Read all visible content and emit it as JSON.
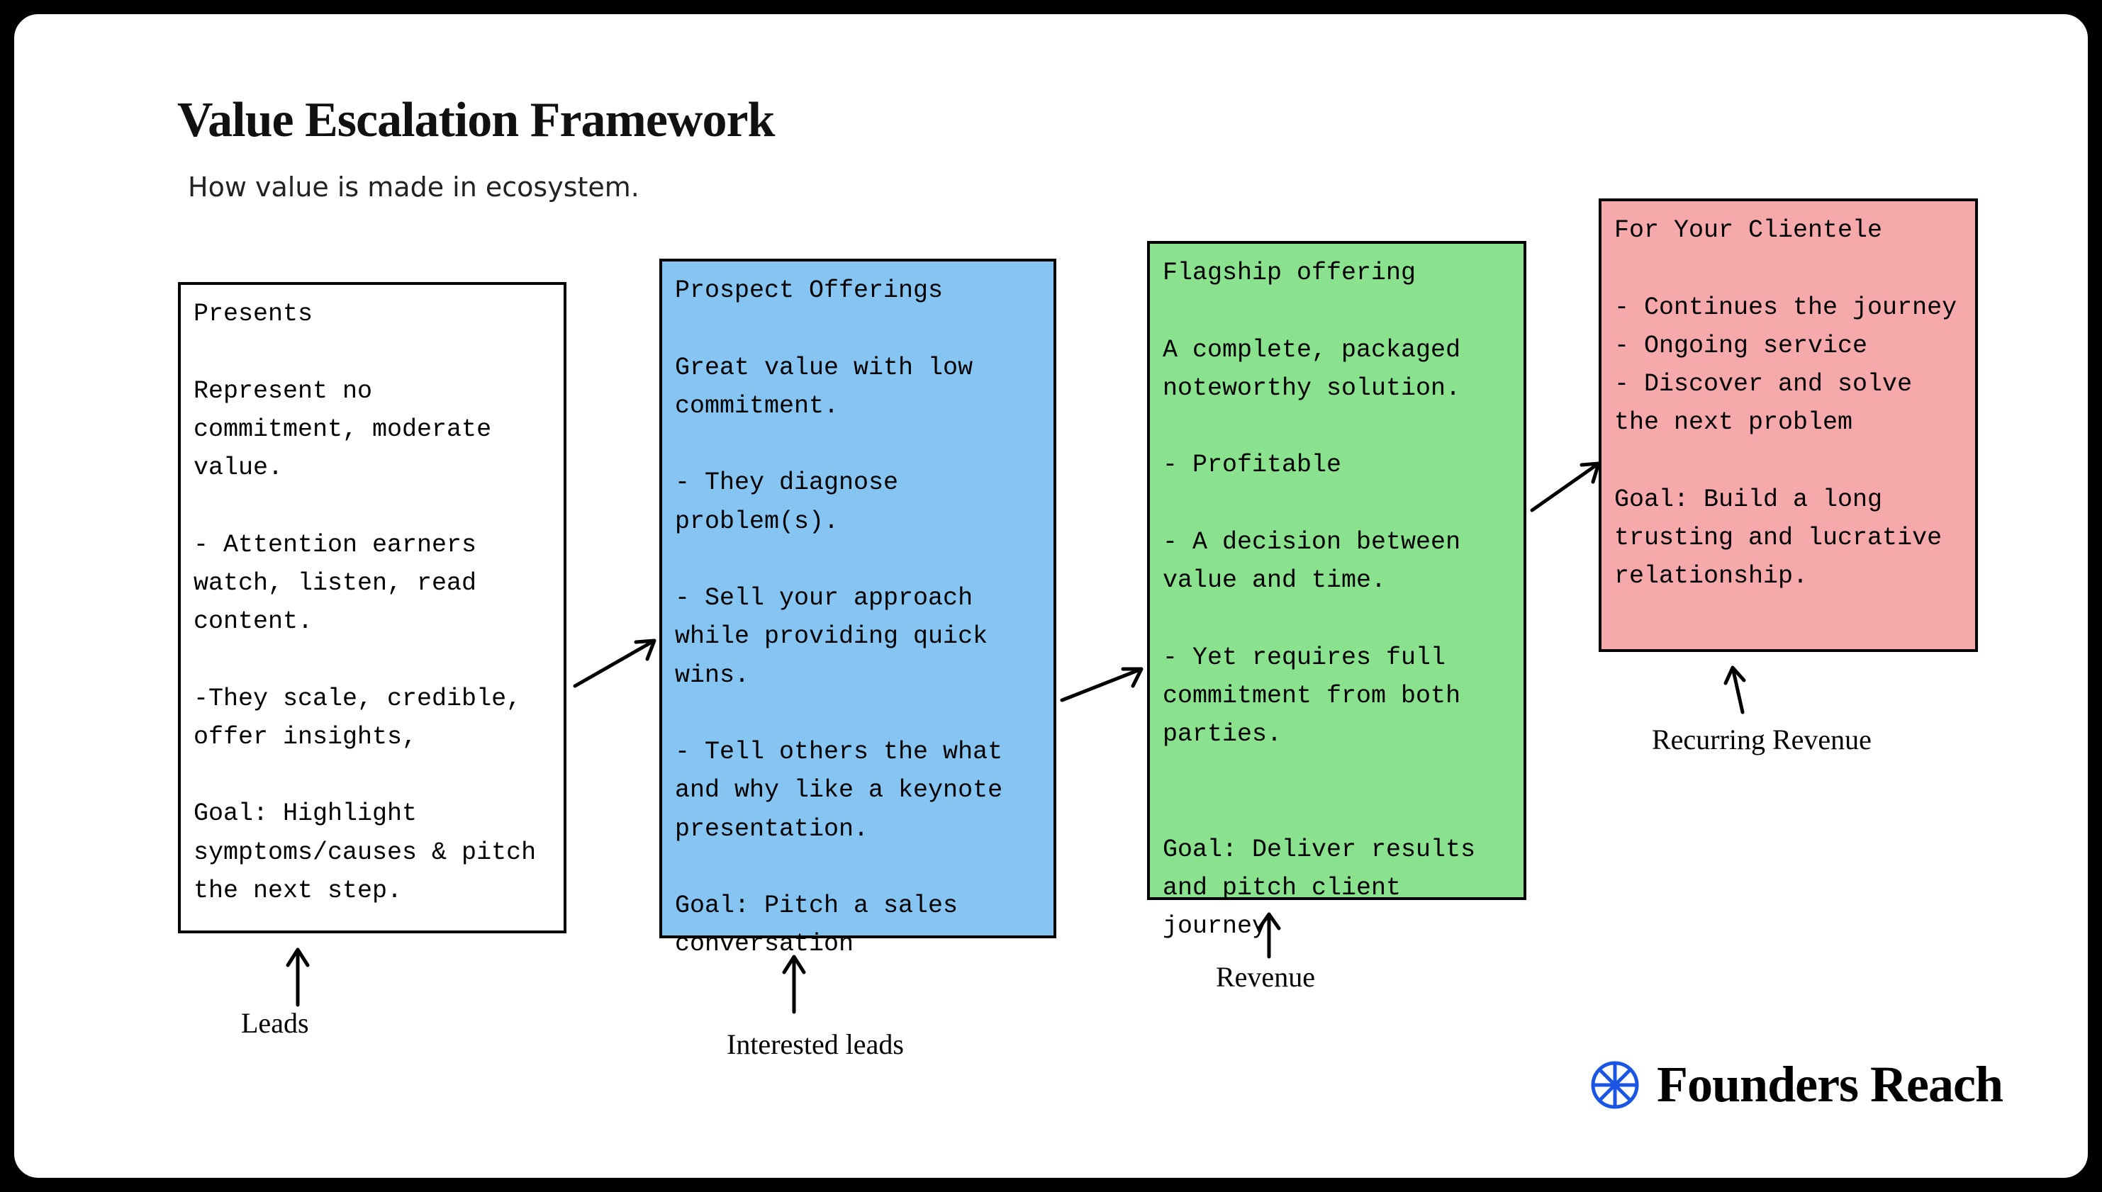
{
  "title": "Value Escalation Framework",
  "subtitle": "How value is made in ecosystem.",
  "boxes": {
    "presents": {
      "label": "Leads",
      "text": "Presents\n\nRepresent no commitment, moderate value.\n\n- Attention earners watch, listen, read content.\n\n-They scale, credible, offer insights,\n\nGoal: Highlight symptoms/causes & pitch the next step."
    },
    "prospect": {
      "label": "Interested leads",
      "text": "Prospect Offerings\n\nGreat value with low commitment.\n\n- They diagnose problem(s).\n\n- Sell your approach while providing quick wins.\n\n- Tell others the what and why like a keynote presentation.\n\nGoal: Pitch a sales conversation"
    },
    "flagship": {
      "label": "Revenue",
      "text": "Flagship offering\n\nA complete, packaged noteworthy solution.\n\n- Profitable\n\n- A decision between value and time.\n\n- Yet requires full commitment from both parties.\n\n\nGoal: Deliver results and pitch client journey"
    },
    "clientele": {
      "label": "Recurring Revenue",
      "text": "For Your Clientele\n\n- Continues the journey\n- Ongoing service\n- Discover and solve the next problem\n\nGoal: Build a long trusting and lucrative relationship."
    }
  },
  "brand": "Founders Reach"
}
